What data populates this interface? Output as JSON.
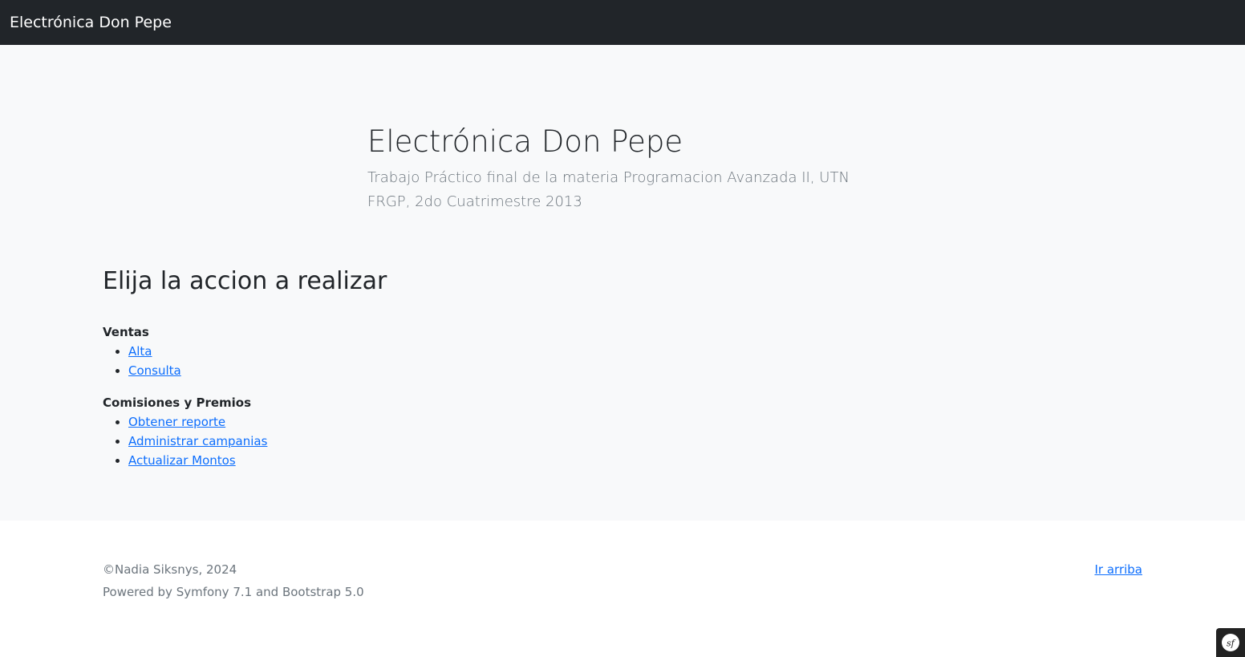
{
  "navbar": {
    "brand": "Electrónica Don Pepe"
  },
  "hero": {
    "title": "Electrónica Don Pepe",
    "lead": "Trabajo Práctico final de la materia Programacion Avanzada II, UTN FRGP, 2do Cuatrimestre 2013"
  },
  "main": {
    "section_title": "Elija la accion a realizar",
    "groups": [
      {
        "heading": "Ventas",
        "links": [
          "Alta",
          "Consulta"
        ]
      },
      {
        "heading": "Comisiones y Premios",
        "links": [
          "Obtener reporte",
          "Administrar campanias",
          "Actualizar Montos"
        ]
      }
    ]
  },
  "footer": {
    "copyright": "©Nadia Siksnys, 2024",
    "powered": "Powered by Symfony 7.1 and Bootstrap 5.0",
    "top_link": "Ir arriba"
  },
  "debug_toolbar": {
    "icon": "symfony-icon"
  },
  "colors": {
    "navbar_bg": "#212529",
    "main_bg": "#f8f9fa",
    "link": "#0d6efd",
    "muted": "#6c757d"
  }
}
